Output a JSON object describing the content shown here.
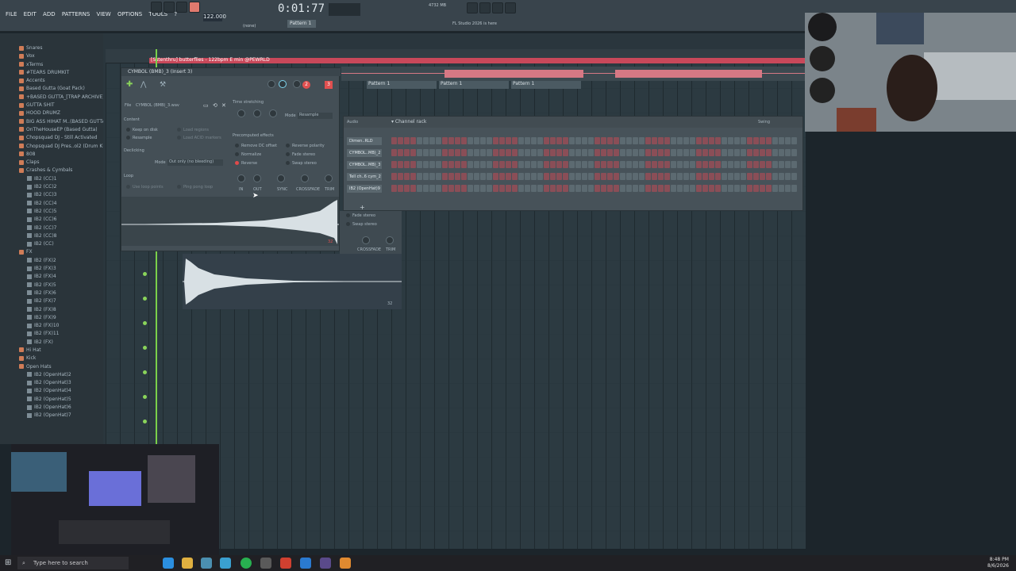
{
  "menu": [
    "FILE",
    "EDIT",
    "ADD",
    "PATTERNS",
    "VIEW",
    "OPTIONS",
    "TOOLS",
    "?"
  ],
  "transport": {
    "time": "0:01:77",
    "tempo": "122.000",
    "pattern": "Pattern 1",
    "pattern_none": "(none)",
    "hint": "FL Studio 2026 is here",
    "mem": "4732 MB"
  },
  "song": {
    "label": "[Sstenthru] butterflies - 122bpm E min @PEWRLD",
    "pattern_clips": [
      "Pattern 1",
      "Pattern 1",
      "Pattern 1"
    ]
  },
  "browser": {
    "items": [
      {
        "label": "Snares",
        "type": "folder"
      },
      {
        "label": "Vox",
        "type": "folder"
      },
      {
        "label": "xTerms",
        "type": "folder"
      },
      {
        "label": "#TEARS DRUMKIT",
        "type": "folder"
      },
      {
        "label": "Accents",
        "type": "folder"
      },
      {
        "label": "Based Gutta (Goat Pack)",
        "type": "folder"
      },
      {
        "label": "+BASED GUTTA_[TRAP ARCHIVE]",
        "type": "folder"
      },
      {
        "label": "GUTTA SHIT",
        "type": "folder"
      },
      {
        "label": "HOOD DRUMZ",
        "type": "folder"
      },
      {
        "label": "BIG ASS HIHAT M..(BASED GUTTA)",
        "type": "folder"
      },
      {
        "label": "OnTheHouseEP (Based Gutta)",
        "type": "folder"
      },
      {
        "label": "Chopsquad DJ - Still Activated",
        "type": "folder"
      },
      {
        "label": "Chopsquad DJ Pres..ol2 (Drum Kit)",
        "type": "folder"
      },
      {
        "label": "808",
        "type": "folder"
      },
      {
        "label": "Claps",
        "type": "folder"
      },
      {
        "label": "Crashes & Cymbals",
        "type": "folder"
      },
      {
        "label": "IB2 (CC)1",
        "type": "file"
      },
      {
        "label": "IB2 (CC)2",
        "type": "file"
      },
      {
        "label": "IB2 (CC)3",
        "type": "file"
      },
      {
        "label": "IB2 (CC)4",
        "type": "file"
      },
      {
        "label": "IB2 (CC)5",
        "type": "file"
      },
      {
        "label": "IB2 (CC)6",
        "type": "file"
      },
      {
        "label": "IB2 (CC)7",
        "type": "file"
      },
      {
        "label": "IB2 (CC)8",
        "type": "file"
      },
      {
        "label": "IB2 (CC)",
        "type": "file"
      },
      {
        "label": "FX",
        "type": "folder"
      },
      {
        "label": "IB2 (FX)2",
        "type": "file"
      },
      {
        "label": "IB2 (FX)3",
        "type": "file"
      },
      {
        "label": "IB2 (FX)4",
        "type": "file"
      },
      {
        "label": "IB2 (FX)5",
        "type": "file"
      },
      {
        "label": "IB2 (FX)6",
        "type": "file"
      },
      {
        "label": "IB2 (FX)7",
        "type": "file"
      },
      {
        "label": "IB2 (FX)8",
        "type": "file"
      },
      {
        "label": "IB2 (FX)9",
        "type": "file"
      },
      {
        "label": "IB2 (FX)10",
        "type": "file"
      },
      {
        "label": "IB2 (FX)11",
        "type": "file"
      },
      {
        "label": "IB2 (FX)",
        "type": "file"
      },
      {
        "label": "Hi Hat",
        "type": "folder"
      },
      {
        "label": "Kick",
        "type": "folder"
      },
      {
        "label": "Open Hats",
        "type": "folder"
      },
      {
        "label": "IB2 (OpenHat)2",
        "type": "file"
      },
      {
        "label": "IB2 (OpenHat)3",
        "type": "file"
      },
      {
        "label": "IB2 (OpenHat)4",
        "type": "file"
      },
      {
        "label": "IB2 (OpenHat)5",
        "type": "file"
      },
      {
        "label": "IB2 (OpenHat)6",
        "type": "file"
      },
      {
        "label": "IB2 (OpenHat)7",
        "type": "file"
      }
    ]
  },
  "sampler": {
    "title": "CYMBOL (BMB)_3 (Insert 3)",
    "file_label": "File",
    "file_value": "CYMBOL (BMB)_3.wav",
    "content_label": "Content",
    "keep_on_disk": "Keep on disk",
    "resample": "Resample",
    "load_regions": "Load regions",
    "load_acid": "Load ACID markers",
    "declicking": "Declicking",
    "mode_label": "Mode",
    "declick_mode": "Out only (no bleeding)",
    "loop_label": "Loop",
    "use_loop_points": "Use loop points",
    "ping_pong": "Ping pong loop",
    "time_stretching": "Time stretching",
    "ts_mode_label": "Mode",
    "ts_mode": "Resample",
    "precomputed": "Precomputed effects",
    "remove_dc": "Remove DC offset",
    "normalize": "Normalize",
    "reverse": "Reverse",
    "reverse_polarity": "Reverse polarity",
    "fade_stereo": "Fade stereo",
    "swap_stereo": "Swap stereo",
    "knobs": [
      "IN",
      "OUT",
      "SYNC",
      "CROSSFADE",
      "TRIM"
    ],
    "badge_2": "2",
    "badge_3": "3",
    "wave_label": "32"
  },
  "channel_rack": {
    "title": "Channel rack",
    "audio": "Audio",
    "swing": "Swing",
    "channels": [
      "Dimen..RLD",
      "CYMBOL..MB)_2",
      "CYMBOL..MB)_3",
      "Tell ch..6 cym_2",
      "IB2 (OpenHat)9"
    ]
  },
  "lower": {
    "fade_stereo": "Fade stereo",
    "swap_stereo": "Swap stereo",
    "crossfade": "CROSSFADE",
    "trim": "TRIM",
    "wave_label": "32"
  },
  "taskbar": {
    "search_placeholder": "Type here to search",
    "time": "8:48 PM",
    "date": "8/6/2026"
  }
}
